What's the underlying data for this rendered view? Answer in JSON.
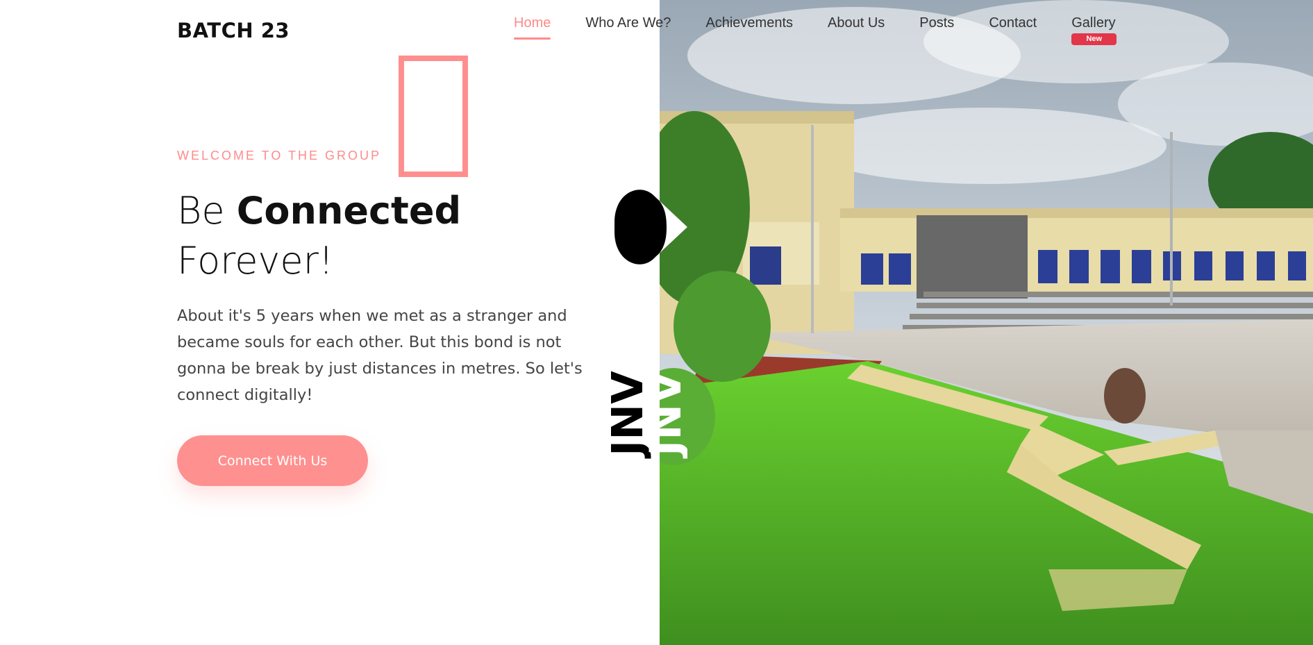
{
  "brand": "BATCH 23",
  "nav": {
    "items": [
      "Home",
      "Who Are We?",
      "Achievements",
      "About Us",
      "Posts",
      "Contact",
      "Gallery"
    ],
    "active": "Home",
    "gallery_badge": "New"
  },
  "hero": {
    "welcome": "WELCOME TO THE GROUP",
    "headline_word1": "Be",
    "headline_bold": "Connected",
    "headline_line2": "Forever!",
    "description": "About it's 5 years when we met as a stranger and became souls for each other. But this bond is not gonna be break by just distances in metres. So let's connect digitally!",
    "cta_label": "Connect With Us"
  },
  "logo": {
    "text": "JNV",
    "icon": "heart-icon"
  },
  "colors": {
    "accent": "#ff8f8f",
    "badge": "#e2364a",
    "text_dark": "#111111"
  }
}
